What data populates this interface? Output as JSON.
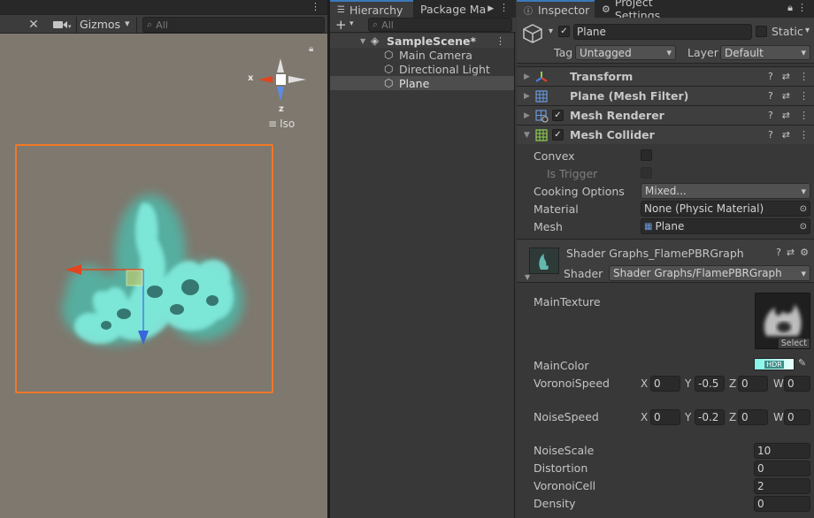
{
  "scene": {
    "toolbar": {
      "gizmos_label": "Gizmos",
      "search_placeholder": "All"
    },
    "gizmo": {
      "x_label": "x",
      "z_label": "z",
      "iso_label": "Iso"
    }
  },
  "hierarchy": {
    "tabs": [
      {
        "label": "Hierarchy"
      },
      {
        "label": "Package Ma"
      }
    ],
    "search_placeholder": "All",
    "scene_name": "SampleScene*",
    "items": [
      {
        "label": "Main Camera"
      },
      {
        "label": "Directional Light"
      },
      {
        "label": "Plane",
        "selected": true
      }
    ]
  },
  "inspector": {
    "tabs": [
      {
        "label": "Inspector"
      },
      {
        "label": "Project Settings"
      }
    ],
    "object": {
      "name": "Plane",
      "active": true,
      "static_label": "Static",
      "tag_label": "Tag",
      "tag_value": "Untagged",
      "layer_label": "Layer",
      "layer_value": "Default"
    },
    "components": [
      {
        "name": "Transform",
        "expanded": false,
        "has_toggle": false
      },
      {
        "name": "Plane (Mesh Filter)",
        "expanded": false,
        "has_toggle": false
      },
      {
        "name": "Mesh Renderer",
        "expanded": false,
        "has_toggle": true,
        "enabled": true
      },
      {
        "name": "Mesh Collider",
        "expanded": true,
        "has_toggle": true,
        "enabled": true
      }
    ],
    "mesh_collider": {
      "convex_label": "Convex",
      "convex": false,
      "is_trigger_label": "Is Trigger",
      "is_trigger": false,
      "cooking_label": "Cooking Options",
      "cooking_value": "Mixed...",
      "material_label": "Material",
      "material_value": "None (Physic Material)",
      "mesh_label": "Mesh",
      "mesh_value": "Plane"
    },
    "material": {
      "title": "Shader Graphs_FlamePBRGraph",
      "shader_label": "Shader",
      "shader_value": "Shader Graphs/FlamePBRGraph",
      "main_texture_label": "MainTexture",
      "select_label": "Select",
      "main_color_label": "MainColor",
      "hdr_label": "HDR",
      "voronoi_speed_label": "VoronoiSpeed",
      "voronoi_speed": {
        "x": "0",
        "y": "-0.5",
        "z": "0",
        "w": "0"
      },
      "noise_speed_label": "NoiseSpeed",
      "noise_speed": {
        "x": "0",
        "y": "-0.2",
        "z": "0",
        "w": "0"
      },
      "axis_labels": {
        "x": "X",
        "y": "Y",
        "z": "Z",
        "w": "W"
      },
      "noise_scale_label": "NoiseScale",
      "noise_scale": "10",
      "distortion_label": "Distortion",
      "distortion": "0",
      "voronoi_cell_label": "VoronoiCell",
      "voronoi_cell": "2",
      "density_label": "Density",
      "density": "0"
    }
  },
  "colors": {
    "accent_blue": "#3a79bb",
    "selection_orange": "#f07828",
    "flame_cyan": "#7ef4e6",
    "scene_bg": "#7e786e",
    "panel_bg": "#383838"
  }
}
